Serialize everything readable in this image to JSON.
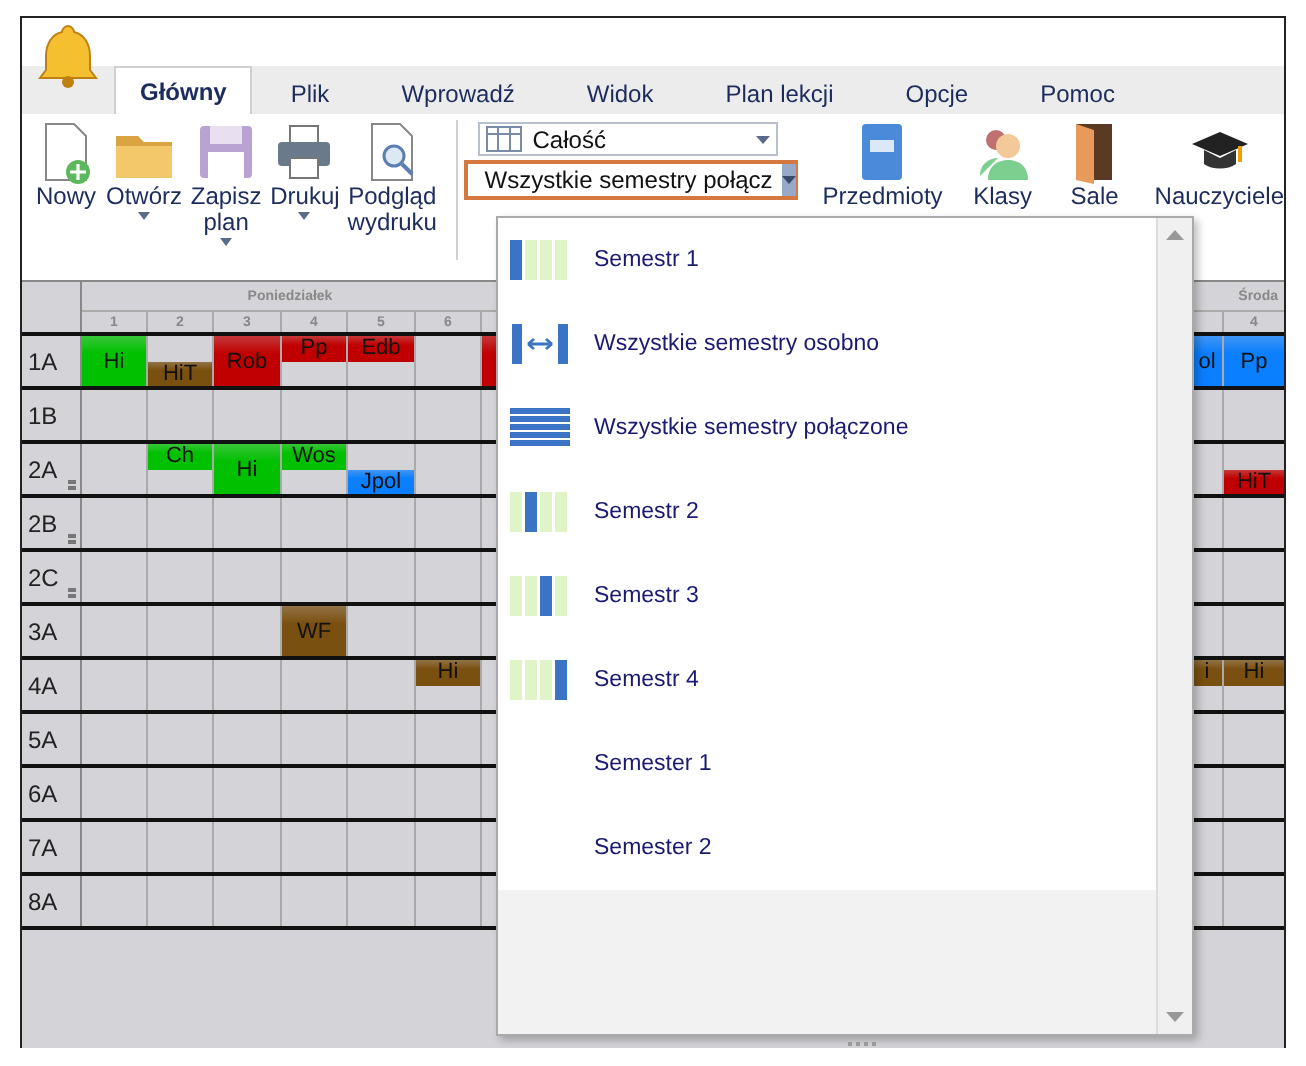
{
  "tabs": [
    {
      "label": "Główny",
      "selected": true
    },
    {
      "label": "Plik",
      "selected": false
    },
    {
      "label": "Wprowadź",
      "selected": false
    },
    {
      "label": "Widok",
      "selected": false
    },
    {
      "label": "Plan lekcji",
      "selected": false
    },
    {
      "label": "Opcje",
      "selected": false
    },
    {
      "label": "Pomoc",
      "selected": false
    }
  ],
  "file_buttons": [
    {
      "kind": "new",
      "label": "Nowy",
      "menu": false
    },
    {
      "kind": "open",
      "label": "Otwórz",
      "menu": true
    },
    {
      "kind": "save",
      "label": "Zapisz plan",
      "menu": true
    },
    {
      "kind": "print",
      "label": "Drukuj",
      "menu": true
    },
    {
      "kind": "preview",
      "label": "Podgląd wydruku",
      "menu": false
    }
  ],
  "view_combo": {
    "value": "Całość"
  },
  "semester_combo": {
    "value": "Wszystkie semestry połącz"
  },
  "entity_buttons": [
    {
      "kind": "subjects",
      "label": "Przedmioty"
    },
    {
      "kind": "classes",
      "label": "Klasy"
    },
    {
      "kind": "rooms",
      "label": "Sale"
    },
    {
      "kind": "teachers",
      "label": "Nauczyciele"
    }
  ],
  "grid": {
    "left_day": "Poniedziałek",
    "left_periods": [
      "1",
      "2",
      "3",
      "4",
      "5",
      "6"
    ],
    "right_day": "Środa",
    "right_periods": [
      "4"
    ],
    "rows": [
      {
        "label": "1A",
        "marked": false,
        "left": [
          {
            "kind": "full",
            "label": "Hi",
            "color": "#00c000"
          },
          {
            "kind": "bottom",
            "label": "HiT",
            "color": "#7a5010"
          },
          {
            "kind": "full",
            "label": "Rob",
            "color": "#c00000"
          },
          {
            "kind": "top",
            "label": "Pp",
            "color": "#c00000"
          },
          {
            "kind": "top",
            "label": "Edb",
            "color": "#c00000"
          },
          {
            "kind": "empty"
          },
          {
            "kind": "full",
            "color": "#c00000"
          }
        ],
        "right": [
          {
            "kind": "full",
            "label": "ol",
            "color": "#0a7fff"
          },
          {
            "kind": "full",
            "label": "Pp",
            "color": "#0a7fff"
          }
        ]
      },
      {
        "label": "1B",
        "marked": false,
        "left": [
          {
            "kind": "empty"
          },
          {
            "kind": "empty"
          },
          {
            "kind": "empty"
          },
          {
            "kind": "empty"
          },
          {
            "kind": "empty"
          },
          {
            "kind": "empty"
          },
          {
            "kind": "empty"
          }
        ],
        "right": [
          {
            "kind": "empty"
          },
          {
            "kind": "empty"
          }
        ]
      },
      {
        "label": "2A",
        "marked": true,
        "left": [
          {
            "kind": "empty"
          },
          {
            "kind": "top",
            "label": "Ch",
            "color": "#00c000"
          },
          {
            "kind": "full",
            "label": "Hi",
            "color": "#00c000"
          },
          {
            "kind": "top",
            "label": "Wos",
            "color": "#00c000"
          },
          {
            "kind": "bottom",
            "label": "Jpol",
            "color": "#0a7fff"
          },
          {
            "kind": "empty"
          },
          {
            "kind": "empty"
          }
        ],
        "right": [
          {
            "kind": "empty"
          },
          {
            "kind": "bottom",
            "label": "HiT",
            "color": "#c00000"
          }
        ]
      },
      {
        "label": "2B",
        "marked": true,
        "left": [
          {
            "kind": "empty"
          },
          {
            "kind": "empty"
          },
          {
            "kind": "empty"
          },
          {
            "kind": "empty"
          },
          {
            "kind": "empty"
          },
          {
            "kind": "empty"
          },
          {
            "kind": "empty"
          }
        ],
        "right": [
          {
            "kind": "empty"
          },
          {
            "kind": "empty"
          }
        ]
      },
      {
        "label": "2C",
        "marked": true,
        "left": [
          {
            "kind": "empty"
          },
          {
            "kind": "empty"
          },
          {
            "kind": "empty"
          },
          {
            "kind": "empty"
          },
          {
            "kind": "empty"
          },
          {
            "kind": "empty"
          },
          {
            "kind": "empty"
          }
        ],
        "right": [
          {
            "kind": "empty"
          },
          {
            "kind": "empty"
          }
        ]
      },
      {
        "label": "3A",
        "marked": false,
        "left": [
          {
            "kind": "empty"
          },
          {
            "kind": "empty"
          },
          {
            "kind": "empty"
          },
          {
            "kind": "full",
            "label": "WF",
            "color": "#7a5010"
          },
          {
            "kind": "empty"
          },
          {
            "kind": "empty"
          },
          {
            "kind": "empty"
          }
        ],
        "right": [
          {
            "kind": "empty"
          },
          {
            "kind": "empty"
          }
        ]
      },
      {
        "label": "4A",
        "marked": false,
        "left": [
          {
            "kind": "empty"
          },
          {
            "kind": "empty"
          },
          {
            "kind": "empty"
          },
          {
            "kind": "empty"
          },
          {
            "kind": "empty"
          },
          {
            "kind": "top",
            "label": "Hi",
            "color": "#7a5010"
          },
          {
            "kind": "empty"
          }
        ],
        "right": [
          {
            "kind": "top",
            "label": "i",
            "color": "#7a5010"
          },
          {
            "kind": "top",
            "label": "Hi",
            "color": "#7a5010"
          }
        ]
      },
      {
        "label": "5A",
        "marked": false,
        "left": [
          {
            "kind": "empty"
          },
          {
            "kind": "empty"
          },
          {
            "kind": "empty"
          },
          {
            "kind": "empty"
          },
          {
            "kind": "empty"
          },
          {
            "kind": "empty"
          },
          {
            "kind": "empty"
          }
        ],
        "right": [
          {
            "kind": "empty"
          },
          {
            "kind": "empty"
          }
        ]
      },
      {
        "label": "6A",
        "marked": false,
        "left": [
          {
            "kind": "empty"
          },
          {
            "kind": "empty"
          },
          {
            "kind": "empty"
          },
          {
            "kind": "empty"
          },
          {
            "kind": "empty"
          },
          {
            "kind": "empty"
          },
          {
            "kind": "empty"
          }
        ],
        "right": [
          {
            "kind": "empty"
          },
          {
            "kind": "empty"
          }
        ]
      },
      {
        "label": "7A",
        "marked": false,
        "left": [
          {
            "kind": "empty"
          },
          {
            "kind": "empty"
          },
          {
            "kind": "empty"
          },
          {
            "kind": "empty"
          },
          {
            "kind": "empty"
          },
          {
            "kind": "empty"
          },
          {
            "kind": "empty"
          }
        ],
        "right": [
          {
            "kind": "empty"
          },
          {
            "kind": "empty"
          }
        ]
      },
      {
        "label": "8A",
        "marked": false,
        "left": [
          {
            "kind": "empty"
          },
          {
            "kind": "empty"
          },
          {
            "kind": "empty"
          },
          {
            "kind": "empty"
          },
          {
            "kind": "empty"
          },
          {
            "kind": "empty"
          },
          {
            "kind": "empty"
          }
        ],
        "right": [
          {
            "kind": "empty"
          },
          {
            "kind": "empty"
          }
        ]
      }
    ]
  },
  "dropdown": {
    "items": [
      {
        "kind": "sem1",
        "label": "Semestr 1"
      },
      {
        "kind": "separate",
        "label": "Wszystkie semestry osobno"
      },
      {
        "kind": "combined",
        "label": "Wszystkie semestry połączone"
      },
      {
        "kind": "sem2",
        "label": "Semestr 2"
      },
      {
        "kind": "sem3",
        "label": "Semestr 3"
      },
      {
        "kind": "sem4",
        "label": "Semestr 4"
      },
      {
        "kind": "none",
        "label": "Semester 1"
      },
      {
        "kind": "none",
        "label": "Semester 2"
      }
    ]
  }
}
